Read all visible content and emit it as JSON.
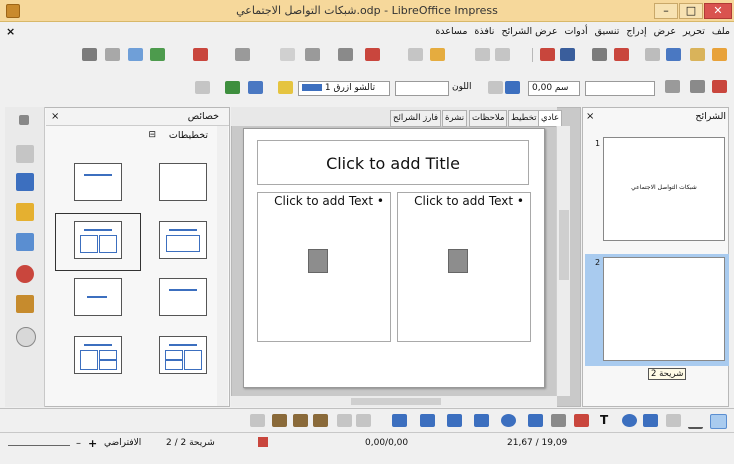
{
  "window": {
    "title": "شبكات التواصل الاجتماعي.odp - LibreOffice Impress",
    "minimize_icon": "minimize-icon",
    "maximize_icon": "maximize-icon",
    "close_icon": "close-icon"
  },
  "menu": {
    "doc_close": "×",
    "items": [
      "ملف",
      "تحرير",
      "عرض",
      "إدراج",
      "تنسيق",
      "أدوات",
      "عرض الشرائح",
      "نافذة",
      "مساعدة"
    ]
  },
  "format_bar": {
    "font_size": "0,00 سم",
    "color_label": "اللون",
    "fill_color": "تالشو ازرق 1"
  },
  "props_panel": {
    "title": "خصائص",
    "section": "تخطيطات",
    "close": "×"
  },
  "tabs": [
    "عادي",
    "تخطيط",
    "ملاحظات",
    "نشرة",
    "فارز الشرائح"
  ],
  "slide": {
    "title_placeholder": "Click to add Title",
    "text_placeholder_left": "Click to add Text",
    "text_placeholder_right": "Click to add Text"
  },
  "slides_panel": {
    "title": "الشرائح",
    "close": "×",
    "slide1_number": "1",
    "slide1_text": "شبكات التواصل الاجتماعي",
    "slide2_number": "2",
    "tooltip": "شريحة 2"
  },
  "statusbar": {
    "slide_info": "شريحة 2 / 2",
    "layout_name": "الافتراضي",
    "position": "0,00/0,00",
    "size": "21,67 / 19,09"
  },
  "colors": {
    "titlebar": "#f6d89b",
    "accent": "#3c6fbf",
    "selection": "#a9cbef"
  }
}
